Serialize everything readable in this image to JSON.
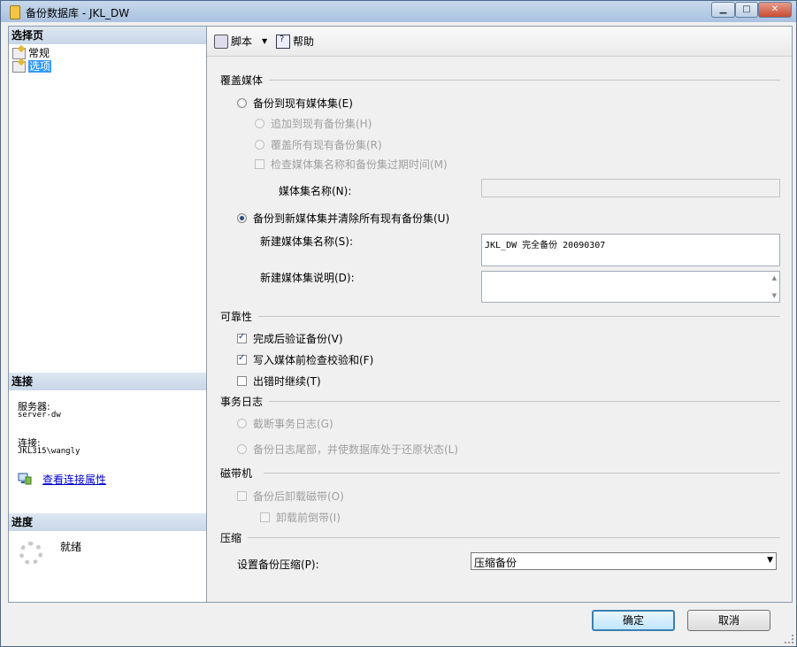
{
  "window": {
    "title": "备份数据库 - JKL_DW"
  },
  "left": {
    "select_page_header": "选择页",
    "pages": [
      {
        "label": "常规"
      },
      {
        "label": "选项"
      }
    ],
    "connection_header": "连接",
    "server_label": "服务器:",
    "server_value": "server-dw",
    "connection_label": "连接:",
    "connection_value": "JKL315\\wangly",
    "view_props_link": "查看连接属性",
    "progress_header": "进度",
    "progress_status": "就绪"
  },
  "toolbar": {
    "script_label": "脚本",
    "help_label": "帮助"
  },
  "overwrite_media": {
    "group_title": "覆盖媒体",
    "backup_existing": "备份到现有媒体集(E)",
    "append": "追加到现有备份集(H)",
    "overwrite_all": "覆盖所有现有备份集(R)",
    "check_name": "检查媒体集名称和备份集过期时间(M)",
    "media_name_label": "媒体集名称(N):",
    "backup_new": "备份到新媒体集并清除所有现有备份集(U)",
    "new_media_name_label": "新建媒体集名称(S):",
    "new_media_name_value": "JKL_DW 完全备份 20090307",
    "new_media_desc_label": "新建媒体集说明(D):"
  },
  "reliability": {
    "group_title": "可靠性",
    "verify": "完成后验证备份(V)",
    "checksum": "写入媒体前检查校验和(F)",
    "continue_on_error": "出错时继续(T)"
  },
  "transaction_log": {
    "group_title": "事务日志",
    "truncate": "截断事务日志(G)",
    "tail_log": "备份日志尾部，并使数据库处于还原状态(L)"
  },
  "tape": {
    "group_title": "磁带机",
    "unload": "备份后卸载磁带(O)",
    "rewind": "卸载前倒带(I)"
  },
  "compression": {
    "group_title": "压缩",
    "label": "设置备份压缩(P):",
    "value": "压缩备份"
  },
  "buttons": {
    "ok": "确定",
    "cancel": "取消"
  }
}
